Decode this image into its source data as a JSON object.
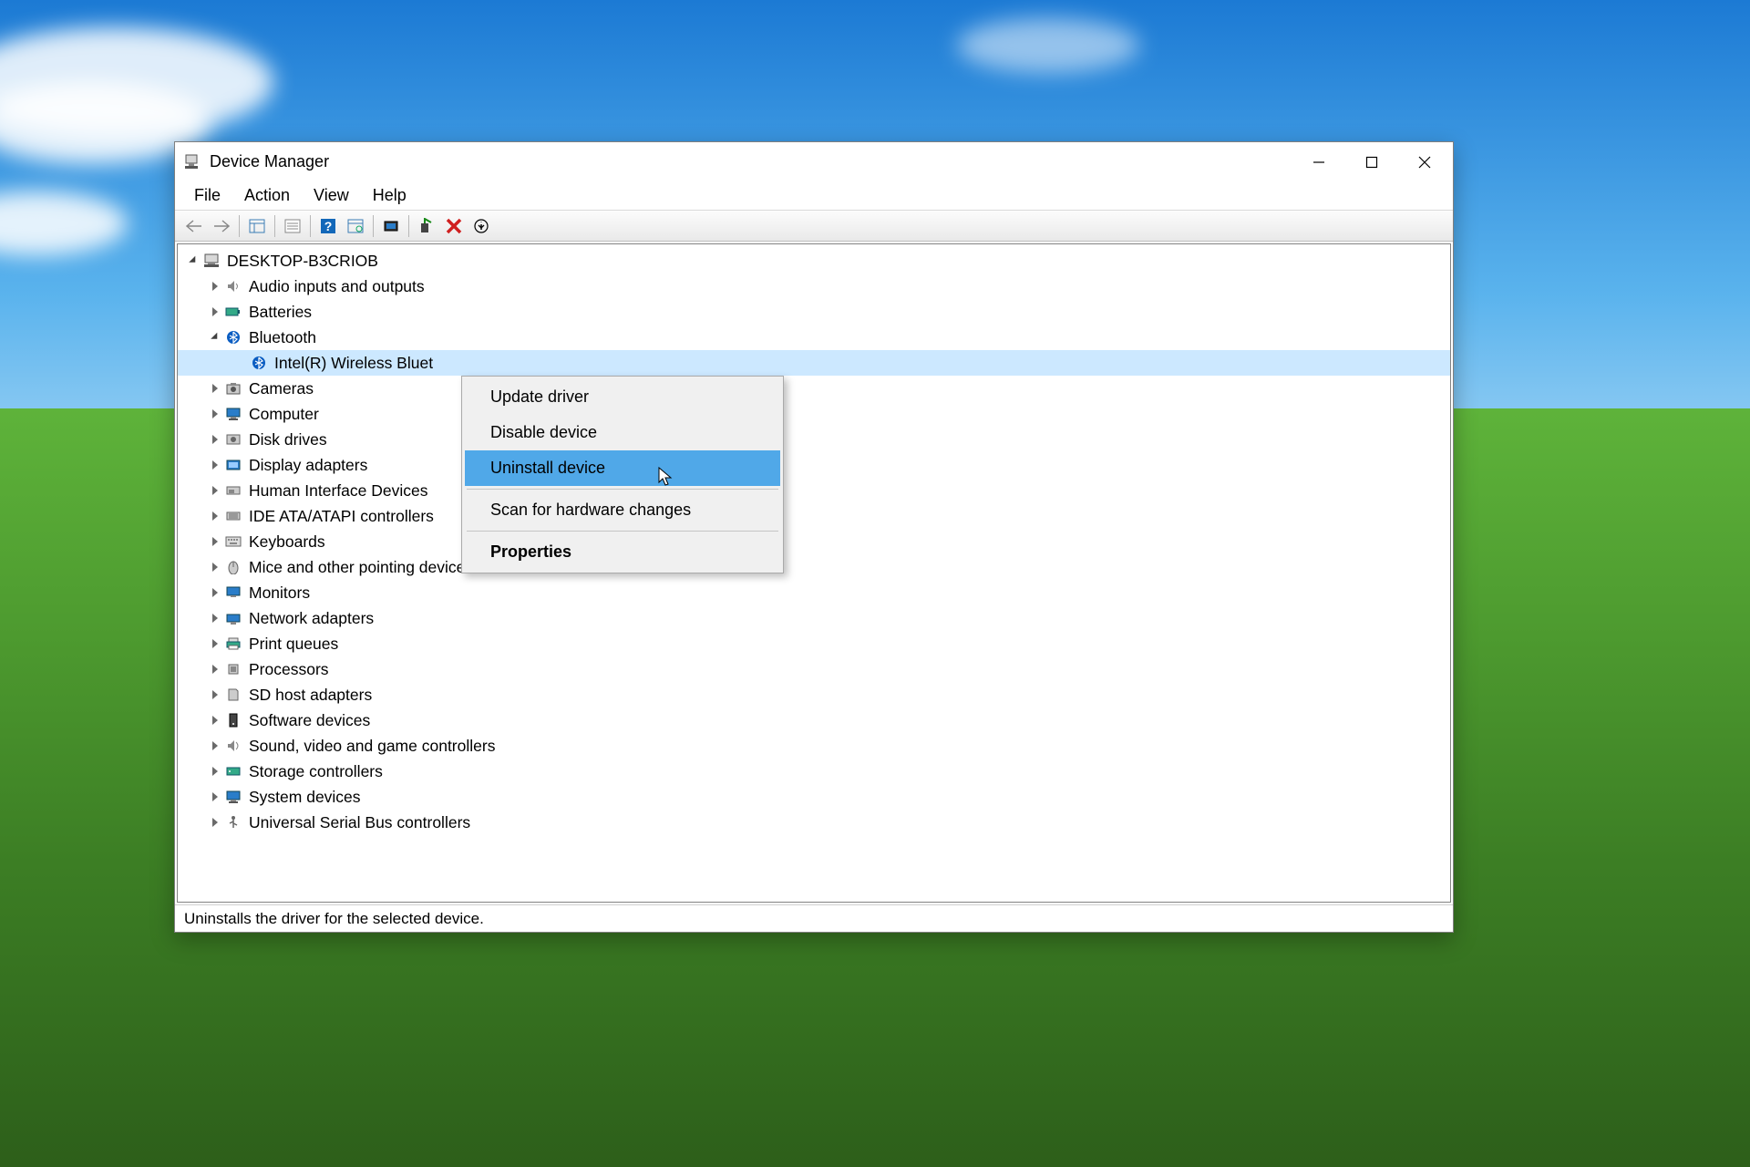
{
  "window": {
    "title": "Device Manager"
  },
  "menubar": {
    "file": "File",
    "action": "Action",
    "view": "View",
    "help": "Help"
  },
  "tree": {
    "root": "DESKTOP-B3CRIOB",
    "audio": "Audio inputs and outputs",
    "batteries": "Batteries",
    "bluetooth": "Bluetooth",
    "bt_intel": "Intel(R) Wireless Bluet",
    "cameras": "Cameras",
    "computer": "Computer",
    "disk": "Disk drives",
    "display": "Display adapters",
    "hid": "Human Interface Devices",
    "ide": "IDE ATA/ATAPI controllers",
    "keyboards": "Keyboards",
    "mice": "Mice and other pointing devices",
    "monitors": "Monitors",
    "network": "Network adapters",
    "print": "Print queues",
    "processors": "Processors",
    "sd": "SD host adapters",
    "software": "Software devices",
    "sound": "Sound, video and game controllers",
    "storage": "Storage controllers",
    "system": "System devices",
    "usb": "Universal Serial Bus controllers"
  },
  "context": {
    "update": "Update driver",
    "disable": "Disable device",
    "uninstall": "Uninstall device",
    "scan": "Scan for hardware changes",
    "properties": "Properties"
  },
  "statusbar": {
    "text": "Uninstalls the driver for the selected device."
  }
}
